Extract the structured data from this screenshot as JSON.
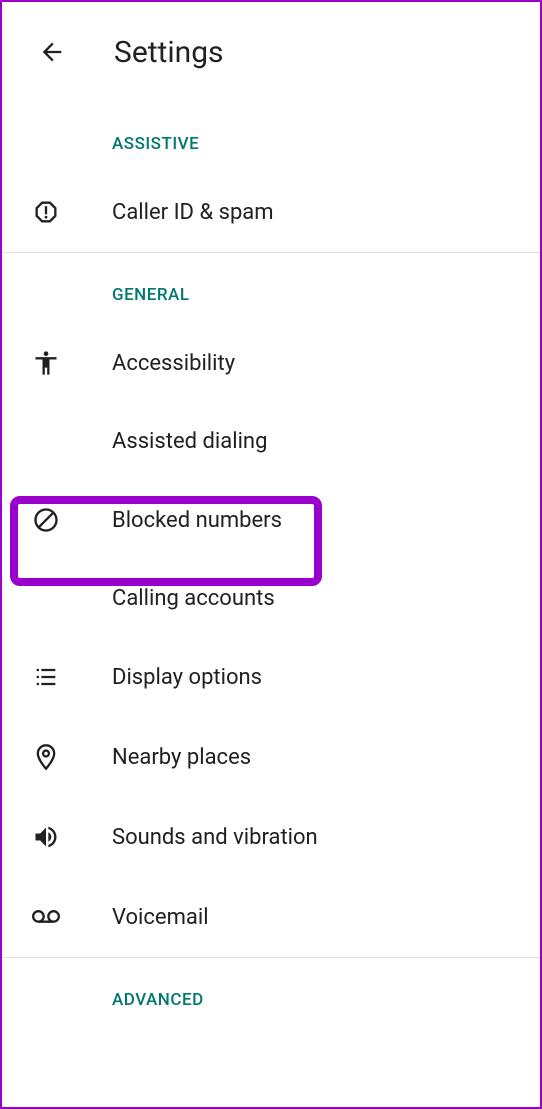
{
  "header": {
    "title": "Settings"
  },
  "sections": {
    "assistive": {
      "header": "ASSISTIVE",
      "items": {
        "caller_id_spam": "Caller ID & spam"
      }
    },
    "general": {
      "header": "GENERAL",
      "items": {
        "accessibility": "Accessibility",
        "assisted_dialing": "Assisted dialing",
        "blocked_numbers": "Blocked numbers",
        "calling_accounts": "Calling accounts",
        "display_options": "Display options",
        "nearby_places": "Nearby places",
        "sounds_vibration": "Sounds and vibration",
        "voicemail": "Voicemail"
      }
    },
    "advanced": {
      "header": "ADVANCED"
    }
  }
}
